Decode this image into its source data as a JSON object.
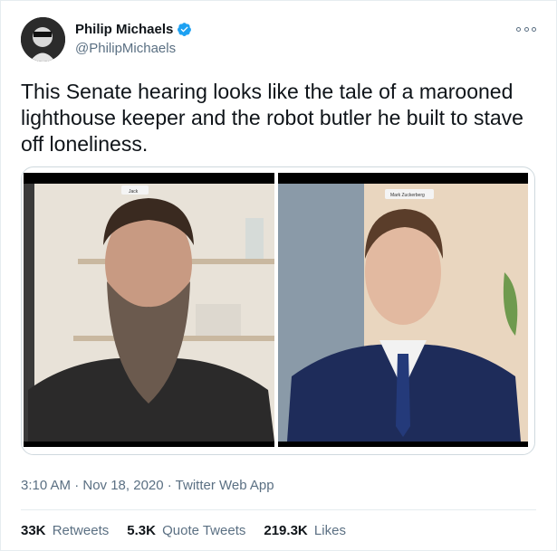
{
  "user": {
    "display_name": "Philip Michaels",
    "handle": "@PhilipMichaels",
    "verified": true
  },
  "tweet": {
    "text": "This Senate hearing looks like the tale of a marooned lighthouse keeper and the robot butler he built to stave off loneliness."
  },
  "media": {
    "left_label": "Jack",
    "right_label": "Mark Zuckerberg"
  },
  "meta": {
    "timestamp": "3:10 AM · Nov 18, 2020 · Twitter Web App"
  },
  "stats": {
    "retweets_count": "33K",
    "retweets_label": "Retweets",
    "quote_count": "5.3K",
    "quote_label": "Quote Tweets",
    "likes_count": "219.3K",
    "likes_label": "Likes"
  },
  "colors": {
    "verified": "#1da1f2",
    "secondary_text": "#5b7083",
    "border": "#e6ecf0"
  },
  "icons": {
    "verified": "verified-badge-icon",
    "more": "more-options-icon"
  }
}
